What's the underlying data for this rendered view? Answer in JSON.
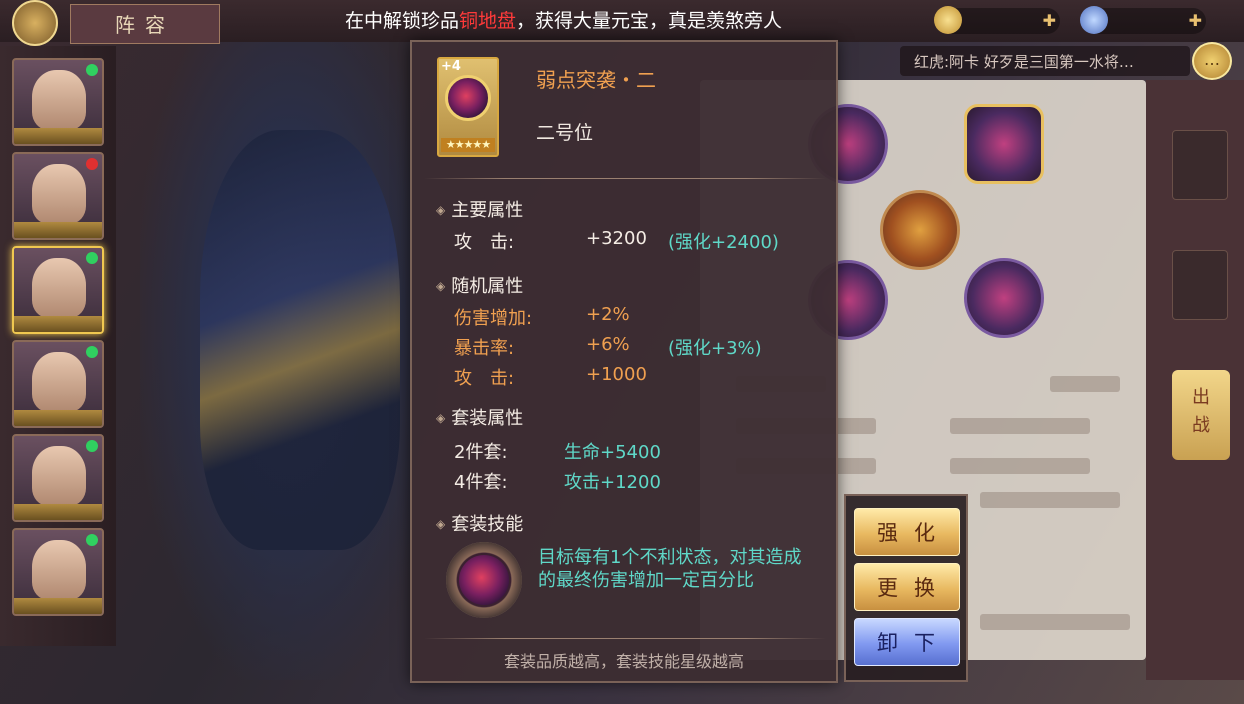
{
  "header": {
    "page_tab": "阵容",
    "ticker_prefix": "在中解锁珍品",
    "ticker_highlight": "铜地盘",
    "ticker_suffix": "，获得大量元宝，真是羡煞旁人"
  },
  "chat": {
    "text": "红虎:阿卡 好歹是三国第一水将…",
    "icon_label": "…"
  },
  "side_tab": {
    "label": "出\n战"
  },
  "item": {
    "level": "+4",
    "stars": "★★★★★",
    "name": "弱点突袭・二",
    "slot": "二号位"
  },
  "main_attr": {
    "title": "主要属性",
    "rows": [
      {
        "label": "攻　击:",
        "value": "+3200",
        "bonus": "(强化+2400)"
      }
    ]
  },
  "random_attr": {
    "title": "随机属性",
    "rows": [
      {
        "label": "伤害增加:",
        "value": "+2%",
        "bonus": ""
      },
      {
        "label": "暴击率:",
        "value": "+6%",
        "bonus": "(强化+3%)"
      },
      {
        "label": "攻　击:",
        "value": "+1000",
        "bonus": ""
      }
    ]
  },
  "set_attr": {
    "title": "套装属性",
    "rows": [
      {
        "label": "2件套:",
        "value": "生命+5400"
      },
      {
        "label": "4件套:",
        "value": "攻击+1200"
      }
    ]
  },
  "set_skill": {
    "title": "套装技能",
    "description": "目标每有1个不利状态，对其造成的最终伤害增加一定百分比"
  },
  "footer_note": "套装品质越高，套装技能星级越高",
  "actions": {
    "enhance": "强化",
    "replace": "更换",
    "unequip": "卸下"
  },
  "colors": {
    "panel_bg": "#3c2d32",
    "orange_text": "#f0a050",
    "cyan_text": "#5fd8c8",
    "highlight_red": "#ff3a3a",
    "gold_button": "#e8b860",
    "blue_button": "#8098f0"
  }
}
